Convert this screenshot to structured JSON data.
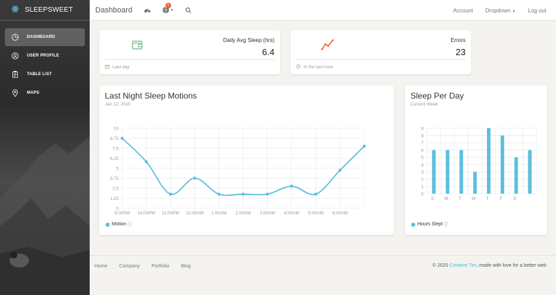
{
  "brand": {
    "name": "SLEEPSWEET"
  },
  "sidebar": {
    "items": [
      {
        "label": "DASHBOARD",
        "icon": "chart-pie-icon",
        "active": true
      },
      {
        "label": "USER PROFILE",
        "icon": "user-icon",
        "active": false
      },
      {
        "label": "TABLE LIST",
        "icon": "clipboard-icon",
        "active": false
      },
      {
        "label": "MAPS",
        "icon": "map-pin-icon",
        "active": false
      }
    ]
  },
  "topbar": {
    "title": "Dashboard",
    "notification_count": "5",
    "account_label": "Account",
    "dropdown_label": "Dropdown",
    "logout_label": "Log out"
  },
  "stats": [
    {
      "label": "Daily Avg Sleep (hrs)",
      "value": "6.4",
      "footer": "Last day",
      "icon": "wallet-icon",
      "icon_color": "#7ac29a",
      "footer_icon": "calendar-icon"
    },
    {
      "label": "Errors",
      "value": "23",
      "footer": "In the last hour",
      "icon": "line-graph-icon",
      "icon_color": "#eb5e28",
      "footer_icon": "clock-icon"
    }
  ],
  "motion_chart": {
    "title": "Last Night Sleep Motions",
    "subtitle": "Jan 12, 2020",
    "legend": "Motion"
  },
  "sleep_chart": {
    "title": "Sleep Per Day",
    "subtitle": "Current Week",
    "legend": "Hours Slept"
  },
  "chart_data": [
    {
      "type": "line",
      "title": "Last Night Sleep Motions",
      "subtitle": "Jan 12, 2020",
      "categories": [
        "9:00PM",
        "10:00PM",
        "11:00PM",
        "12:00AM",
        "1:00AM",
        "2:00AM",
        "3:00AM",
        "4:00AM",
        "5:00AM",
        "6:00AM"
      ],
      "series": [
        {
          "name": "Motion",
          "color": "#5bc0de",
          "values": [
            8.75,
            5.8,
            1.75,
            3.75,
            1.75,
            1.75,
            1.75,
            2.75,
            1.75,
            4.75,
            7.75
          ]
        }
      ],
      "ylim": [
        0,
        10
      ],
      "yticks": [
        "0",
        "1.25",
        "2.5",
        "3.75",
        "5",
        "6.25",
        "7.5",
        "8.75",
        "10"
      ],
      "grid": true,
      "legend": "bottom-left"
    },
    {
      "type": "bar",
      "title": "Sleep Per Day",
      "subtitle": "Current Week",
      "categories": [
        "S",
        "M",
        "T",
        "W",
        "T",
        "F",
        "S"
      ],
      "series": [
        {
          "name": "Hours Slept",
          "color": "#5bc0de",
          "values": [
            6,
            6,
            6,
            3,
            9,
            8,
            5,
            6
          ]
        }
      ],
      "ylim": [
        0,
        9
      ],
      "yticks": [
        "0",
        "1",
        "2",
        "3",
        "4",
        "5",
        "6",
        "7",
        "8",
        "9"
      ],
      "grid": true,
      "legend": "bottom-left"
    }
  ],
  "footer": {
    "links": [
      "Home",
      "Company",
      "Portfolio",
      "Blog"
    ],
    "copyright_prefix": "© 2020",
    "copyright_author": "Creative Tim",
    "copyright_suffix": ", made with love for a better web"
  }
}
